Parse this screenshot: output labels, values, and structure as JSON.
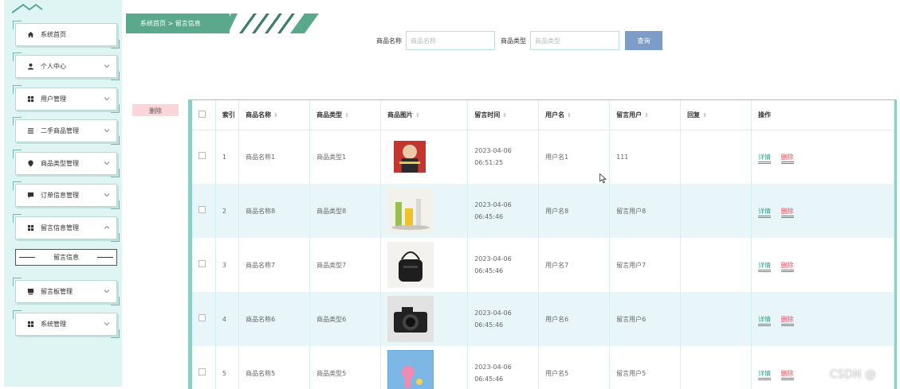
{
  "breadcrumb": {
    "text": "系统首页 > 留言信息"
  },
  "sidebar": {
    "items": [
      {
        "label": "系统首页",
        "icon": "home-icon"
      },
      {
        "label": "个人中心",
        "icon": "user-icon"
      },
      {
        "label": "用户管理",
        "icon": "grid-icon"
      },
      {
        "label": "二手商品管理",
        "icon": "list-icon"
      },
      {
        "label": "商品类型管理",
        "icon": "pin-icon"
      },
      {
        "label": "订单信息管理",
        "icon": "chat-icon"
      },
      {
        "label": "留言信息管理",
        "icon": "grid-icon"
      },
      {
        "label": "留言板管理",
        "icon": "board-icon"
      },
      {
        "label": "系统管理",
        "icon": "grid-icon"
      }
    ],
    "sub_item": "留言信息"
  },
  "search": {
    "name_label": "商品名称",
    "name_placeholder": "商品名称",
    "type_label": "商品类型",
    "type_placeholder": "商品类型",
    "button": "查询"
  },
  "actions": {
    "delete": "删除"
  },
  "table": {
    "columns": [
      "索引",
      "商品名称",
      "商品类型",
      "商品图片",
      "留言时间",
      "用户名",
      "留言用户",
      "回复",
      "操作"
    ],
    "rows": [
      {
        "idx": "1",
        "name": "商品名称1",
        "type": "商品类型1",
        "time": "2023-04-06 06:51:25",
        "user": "用户名1",
        "msg_user": "111",
        "reply": "",
        "detail": "详情",
        "del": "删除"
      },
      {
        "idx": "2",
        "name": "商品名称8",
        "type": "商品类型8",
        "time": "2023-04-06 06:45:46",
        "user": "用户名8",
        "msg_user": "留言用户8",
        "reply": "",
        "detail": "详情",
        "del": "删除"
      },
      {
        "idx": "3",
        "name": "商品名称7",
        "type": "商品类型7",
        "time": "2023-04-06 06:45:46",
        "user": "用户名7",
        "msg_user": "留言用户7",
        "reply": "",
        "detail": "详情",
        "del": "删除"
      },
      {
        "idx": "4",
        "name": "商品名称6",
        "type": "商品类型6",
        "time": "2023-04-06 06:45:46",
        "user": "用户名6",
        "msg_user": "留言用户6",
        "reply": "",
        "detail": "详情",
        "del": "删除"
      },
      {
        "idx": "5",
        "name": "商品名称5",
        "type": "商品类型5",
        "time": "2023-04-06 06:45:46",
        "user": "用户名5",
        "msg_user": "留言用户5",
        "reply": "",
        "detail": "详情",
        "del": "删除"
      }
    ]
  },
  "watermark": "CSDN @"
}
